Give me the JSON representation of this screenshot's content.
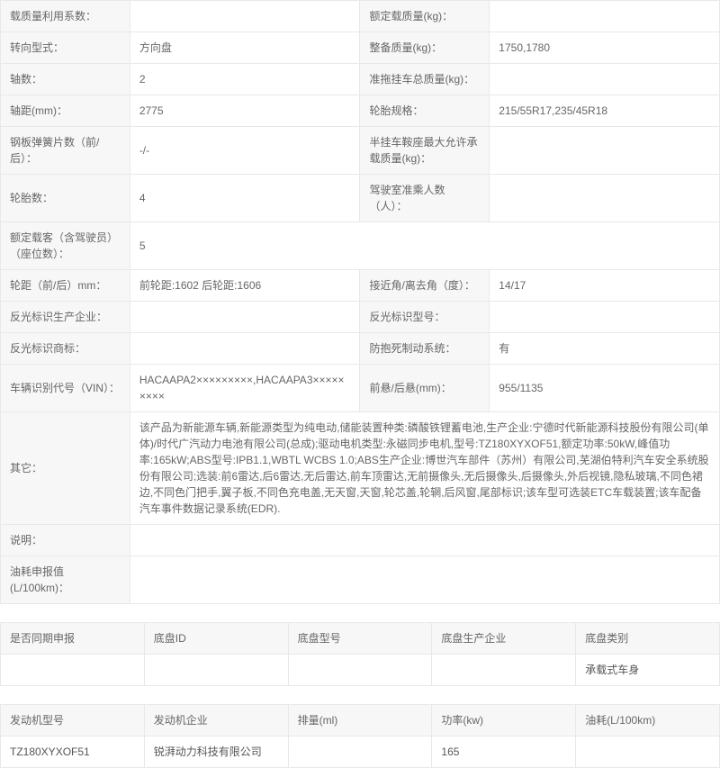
{
  "t1": {
    "r1": {
      "l1": "载质量利用系数：",
      "v1": "",
      "l2": "额定载质量(kg)：",
      "v2": ""
    },
    "r2": {
      "l1": "转向型式：",
      "v1": "方向盘",
      "l2": "整备质量(kg)：",
      "v2": "1750,1780"
    },
    "r3": {
      "l1": "轴数：",
      "v1": "2",
      "l2": "准拖挂车总质量(kg)：",
      "v2": ""
    },
    "r4": {
      "l1": "轴距(mm)：",
      "v1": "2775",
      "l2": "轮胎规格：",
      "v2": "215/55R17,235/45R18"
    },
    "r5": {
      "l1": "钢板弹簧片数（前/后）：",
      "v1": "-/-",
      "l2": "半挂车鞍座最大允许承载质量(kg)：",
      "v2": ""
    },
    "r6": {
      "l1": "轮胎数：",
      "v1": "4",
      "l2": "驾驶室准乘人数（人）：",
      "v2": ""
    },
    "r7": {
      "l1": "额定载客（含驾驶员）（座位数）：",
      "v1": "5"
    },
    "r8": {
      "l1": "轮距（前/后）mm：",
      "v1": "前轮距:1602 后轮距:1606",
      "l2": "接近角/离去角（度）：",
      "v2": "14/17"
    },
    "r9": {
      "l1": "反光标识生产企业：",
      "v1": "",
      "l2": "反光标识型号：",
      "v2": ""
    },
    "r10": {
      "l1": "反光标识商标：",
      "v1": "",
      "l2": "防抱死制动系统：",
      "v2": "有"
    },
    "r11": {
      "l1": "车辆识别代号（VIN）：",
      "v1": "HACAAPA2×××××××××,HACAAPA3×××××××××",
      "l2": "前悬/后悬(mm)：",
      "v2": "955/1135"
    },
    "r12": {
      "l1": "其它：",
      "v1": "该产品为新能源车辆,新能源类型为纯电动,储能装置种类:磷酸铁锂蓄电池,生产企业:宁德时代新能源科技股份有限公司(单体)/时代广汽动力电池有限公司(总成);驱动电机类型:永磁同步电机,型号:TZ180XYXOF51,额定功率:50kW,峰值功率:165kW;ABS型号:IPB1.1,WBTL WCBS 1.0;ABS生产企业:博世汽车部件（苏州）有限公司,芜湖伯特利汽车安全系统股份有限公司;选装:前6雷达,后6雷达,无后雷达,前车顶雷达,无前摄像头,无后摄像头,后摄像头,外后视镜,隐私玻璃,不同色裙边,不同色门把手,翼子板,不同色充电盖,无天窗,天窗,轮芯盖,轮辋,后风窗,尾部标识;该车型可选装ETC车载装置;该车配备汽车事件数据记录系统(EDR)."
    },
    "r13": {
      "l1": "说明：",
      "v1": ""
    },
    "r14": {
      "l1": "油耗申报值(L/100km)：",
      "v1": ""
    }
  },
  "t2": {
    "h": [
      "是否同期申报",
      "底盘ID",
      "底盘型号",
      "底盘生产企业",
      "底盘类别"
    ],
    "row": [
      "",
      "",
      "",
      "",
      "承载式车身"
    ]
  },
  "t3": {
    "h": [
      "发动机型号",
      "发动机企业",
      "排量(ml)",
      "功率(kw)",
      "油耗(L/100km)"
    ],
    "row": [
      "TZ180XYXOF51",
      "锐湃动力科技有限公司",
      "",
      "165",
      ""
    ]
  }
}
